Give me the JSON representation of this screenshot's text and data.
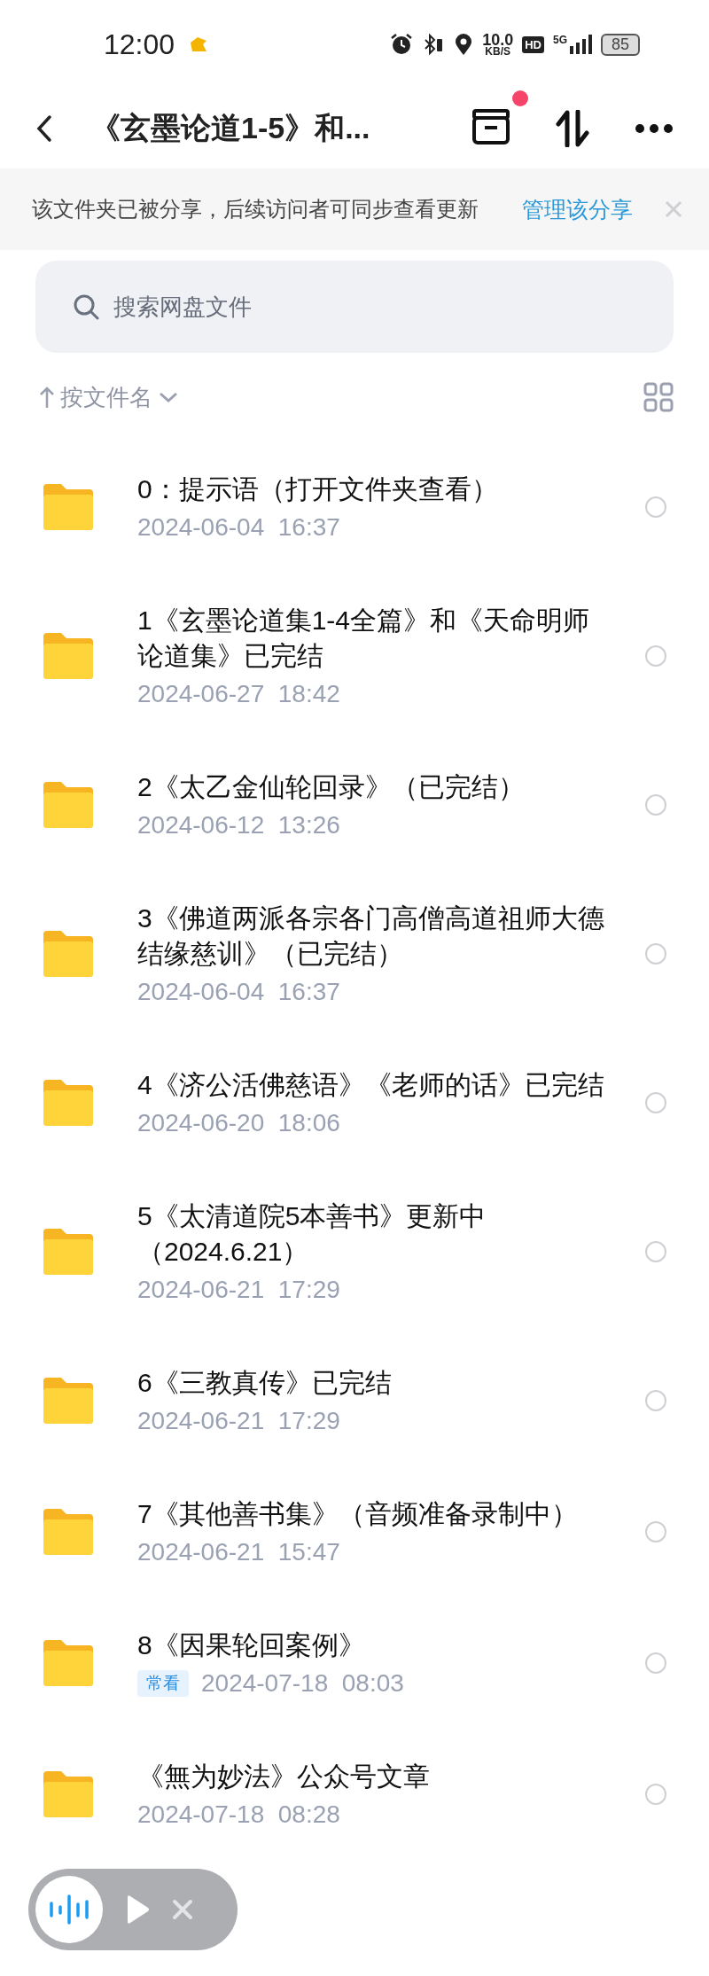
{
  "status_bar": {
    "time": "12:00",
    "net_speed": "10.0",
    "net_unit": "KB/S",
    "hd": "HD",
    "network": "5G",
    "battery": "85"
  },
  "header": {
    "title": "《玄墨论道1-5》和...",
    "notification_dot": true
  },
  "banner": {
    "text": "该文件夹已被分享，后续访问者可同步查看更新",
    "link": "管理该分享"
  },
  "search": {
    "placeholder": "搜索网盘文件"
  },
  "sort": {
    "label": "按文件名"
  },
  "files": [
    {
      "name": "0：提示语（打开文件夹查看）",
      "datetime": "2024-06-04  16:37",
      "selected": false
    },
    {
      "name": "1《玄墨论道集1-4全篇》和《天命明师论道集》已完结",
      "datetime": "2024-06-27  18:42",
      "selected": false
    },
    {
      "name": "2《太乙金仙轮回录》（已完结）",
      "datetime": "2024-06-12  13:26",
      "selected": false
    },
    {
      "name": "3《佛道两派各宗各门高僧高道祖师大德结缘慈训》（已完结）",
      "datetime": "2024-06-04  16:37",
      "selected": false
    },
    {
      "name": "4《济公活佛慈语》《老师的话》已完结",
      "datetime": "2024-06-20  18:06",
      "selected": false
    },
    {
      "name": "5《太清道院5本善书》更新中（2024.6.21）",
      "datetime": "2024-06-21  17:29",
      "selected": false
    },
    {
      "name": "6《三教真传》已完结",
      "datetime": "2024-06-21  17:29",
      "selected": false
    },
    {
      "name": "7《其他善书集》（音频准备录制中）",
      "datetime": "2024-06-21  15:47",
      "selected": false
    },
    {
      "name": "8《因果轮回案例》",
      "tag": "常看",
      "datetime": "2024-07-18  08:03",
      "selected": false
    },
    {
      "name": "《無为妙法》公众号文章",
      "datetime": "2024-07-18  08:28",
      "selected": false
    }
  ]
}
